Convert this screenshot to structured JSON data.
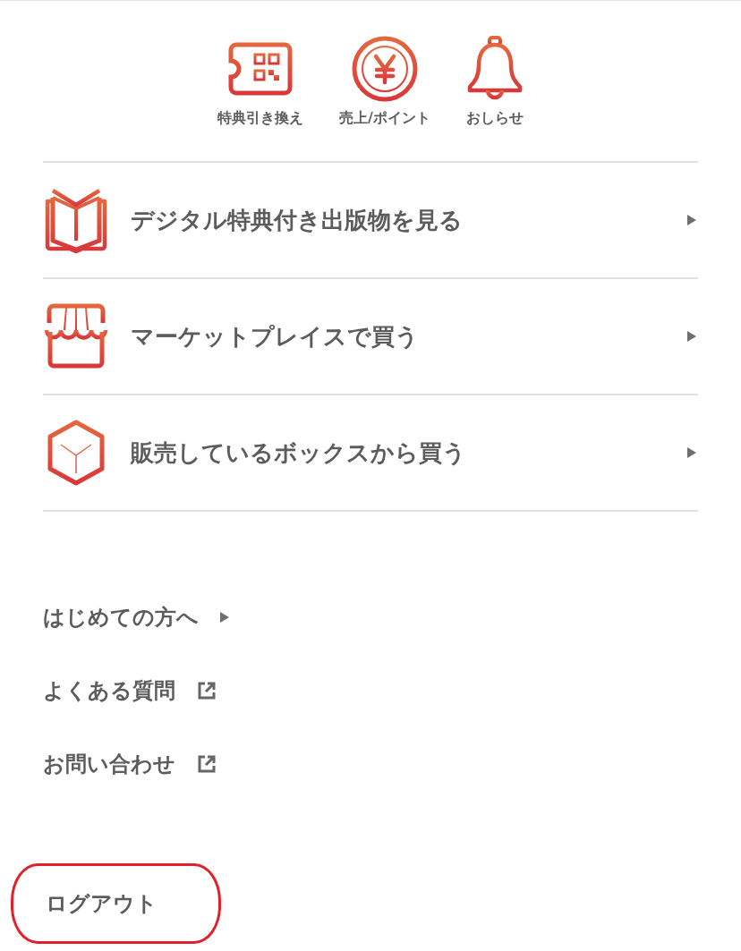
{
  "quick_actions": [
    {
      "label": "特典引き換え",
      "kind": "ticket"
    },
    {
      "label": "売上/ポイント",
      "kind": "coin"
    },
    {
      "label": "おしらせ",
      "kind": "bell"
    }
  ],
  "menu": [
    {
      "label": "デジタル特典付き出版物を見る",
      "kind": "book"
    },
    {
      "label": "マーケットプレイスで買う",
      "kind": "store"
    },
    {
      "label": "販売しているボックスから買う",
      "kind": "box"
    }
  ],
  "links": [
    {
      "label": "はじめての方へ",
      "kind": "internal"
    },
    {
      "label": "よくある質問",
      "kind": "external"
    },
    {
      "label": "お問い合わせ",
      "kind": "external"
    }
  ],
  "logout": {
    "label": "ログアウト",
    "highlighted": true
  }
}
